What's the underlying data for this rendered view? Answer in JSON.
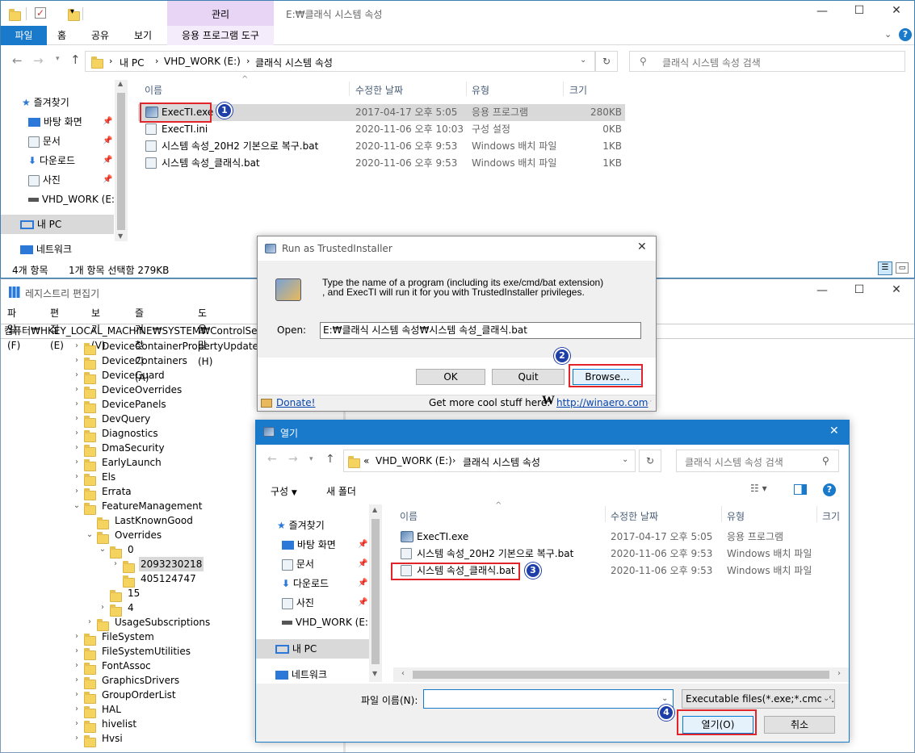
{
  "explorer": {
    "title_path": "E:₩클래식 시스템 속성",
    "ribbon_context_tab": "관리",
    "ribbon_tabs": [
      "파일",
      "홈",
      "공유",
      "보기"
    ],
    "ribbon_context_sub": "응용 프로그램 도구",
    "address": {
      "this_pc": "내 PC",
      "drive": "VHD_WORK (E:)",
      "folder": "클래식 시스템 속성"
    },
    "search_placeholder": "클래식 시스템 속성 검색",
    "nav": {
      "quick_access": "즐겨찾기",
      "desktop": "바탕 화면",
      "documents": "문서",
      "downloads": "다운로드",
      "pictures": "사진",
      "vhd": "VHD_WORK (E:)",
      "this_pc": "내 PC",
      "network": "네트워크"
    },
    "columns": {
      "name": "이름",
      "modified": "수정한 날짜",
      "type": "유형",
      "size": "크기"
    },
    "files": [
      {
        "name": "ExecTI.exe",
        "modified": "2017-04-17 오후 5:05",
        "type": "응용 프로그램",
        "size": "280KB"
      },
      {
        "name": "ExecTI.ini",
        "modified": "2020-11-06 오후 10:03",
        "type": "구성 설정",
        "size": "0KB"
      },
      {
        "name": "시스템 속성_20H2 기본으로 복구.bat",
        "modified": "2020-11-06 오후 9:53",
        "type": "Windows 배치 파일",
        "size": "1KB"
      },
      {
        "name": "시스템 속성_클래식.bat",
        "modified": "2020-11-06 오후 9:53",
        "type": "Windows 배치 파일",
        "size": "1KB"
      }
    ],
    "status_count": "4개 항목",
    "status_selected": "1개 항목 선택함 279KB"
  },
  "regedit": {
    "title": "레지스트리 편집기",
    "menu": [
      "파일(F)",
      "편집(E)",
      "보기(V)",
      "즐겨찾기(A)",
      "도움말(H)"
    ],
    "path": "컴퓨터₩HKEY_LOCAL_MACHINE₩SYSTEM₩ControlSet001",
    "tree": [
      {
        "label": "DeviceContainerPropertyUpdateEvents",
        "indent": 0,
        "expand": ">"
      },
      {
        "label": "DeviceContainers",
        "indent": 0,
        "expand": ">"
      },
      {
        "label": "DeviceGuard",
        "indent": 0,
        "expand": ">"
      },
      {
        "label": "DeviceOverrides",
        "indent": 0,
        "expand": ">"
      },
      {
        "label": "DevicePanels",
        "indent": 0,
        "expand": ">"
      },
      {
        "label": "DevQuery",
        "indent": 0,
        "expand": ">"
      },
      {
        "label": "Diagnostics",
        "indent": 0,
        "expand": ">"
      },
      {
        "label": "DmaSecurity",
        "indent": 0,
        "expand": ">"
      },
      {
        "label": "EarlyLaunch",
        "indent": 0,
        "expand": ">"
      },
      {
        "label": "Els",
        "indent": 0,
        "expand": ">"
      },
      {
        "label": "Errata",
        "indent": 0,
        "expand": ">"
      },
      {
        "label": "FeatureManagement",
        "indent": 0,
        "expand": "v"
      },
      {
        "label": "LastKnownGood",
        "indent": 1,
        "expand": ""
      },
      {
        "label": "Overrides",
        "indent": 1,
        "expand": "v"
      },
      {
        "label": "0",
        "indent": 2,
        "expand": "v"
      },
      {
        "label": "2093230218",
        "indent": 3,
        "expand": ">",
        "selected": true
      },
      {
        "label": "405124747",
        "indent": 3,
        "expand": ""
      },
      {
        "label": "15",
        "indent": 2,
        "expand": ""
      },
      {
        "label": "4",
        "indent": 2,
        "expand": ">"
      },
      {
        "label": "UsageSubscriptions",
        "indent": 1,
        "expand": ">"
      },
      {
        "label": "FileSystem",
        "indent": 0,
        "expand": ">"
      },
      {
        "label": "FileSystemUtilities",
        "indent": 0,
        "expand": ">"
      },
      {
        "label": "FontAssoc",
        "indent": 0,
        "expand": ">"
      },
      {
        "label": "GraphicsDrivers",
        "indent": 0,
        "expand": ">"
      },
      {
        "label": "GroupOrderList",
        "indent": 0,
        "expand": ">"
      },
      {
        "label": "HAL",
        "indent": 0,
        "expand": ">"
      },
      {
        "label": "hivelist",
        "indent": 0,
        "expand": ">"
      },
      {
        "label": "Hvsi",
        "indent": 0,
        "expand": ">"
      }
    ]
  },
  "ti_dialog": {
    "title": "Run as TrustedInstaller",
    "desc1": "Type the name of a program (including its exe/cmd/bat extension)",
    "desc2": ", and ExecTI will run it for you with TrustedInstaller privileges.",
    "open_label": "Open:",
    "open_value": "E:₩클래식 시스템 속성₩시스템 속성_클래식.bat",
    "ok": "OK",
    "quit": "Quit",
    "browse": "Browse...",
    "donate": "Donate!",
    "more": "Get more cool stuff here:",
    "winaero_logo": "W",
    "link": "http://winaero.com"
  },
  "open_dialog": {
    "title": "열기",
    "address": {
      "prefix": "«",
      "drive": "VHD_WORK (E:)",
      "folder": "클래식 시스템 속성"
    },
    "search_placeholder": "클래식 시스템 속성 검색",
    "organize": "구성",
    "new_folder": "새 폴더",
    "nav": {
      "quick_access": "즐겨찾기",
      "desktop": "바탕 화면",
      "documents": "문서",
      "downloads": "다운로드",
      "pictures": "사진",
      "vhd": "VHD_WORK (E:)",
      "this_pc": "내 PC",
      "network": "네트워크"
    },
    "columns": {
      "name": "이름",
      "modified": "수정한 날짜",
      "type": "유형",
      "size": "크기"
    },
    "files": [
      {
        "name": "ExecTI.exe",
        "modified": "2017-04-17 오후 5:05",
        "type": "응용 프로그램"
      },
      {
        "name": "시스템 속성_20H2 기본으로 복구.bat",
        "modified": "2020-11-06 오후 9:53",
        "type": "Windows 배치 파일"
      },
      {
        "name": "시스템 속성_클래식.bat",
        "modified": "2020-11-06 오후 9:53",
        "type": "Windows 배치 파일"
      }
    ],
    "filename_label": "파일 이름(N):",
    "filename_value": "",
    "filter": "Executable files(*.exe;*.cmd;*.b",
    "open_btn": "열기(O)",
    "cancel_btn": "취소"
  },
  "badges": [
    "1",
    "2",
    "3",
    "4"
  ],
  "colors": {
    "accent": "#0078d7",
    "ribbon_context": "#e8d5f5",
    "highlight": "#cce8ff",
    "selected": "#d9d9d9",
    "annotation_red": "#e0242a",
    "badge_blue": "#1f3fa8",
    "link": "#0645ad"
  }
}
